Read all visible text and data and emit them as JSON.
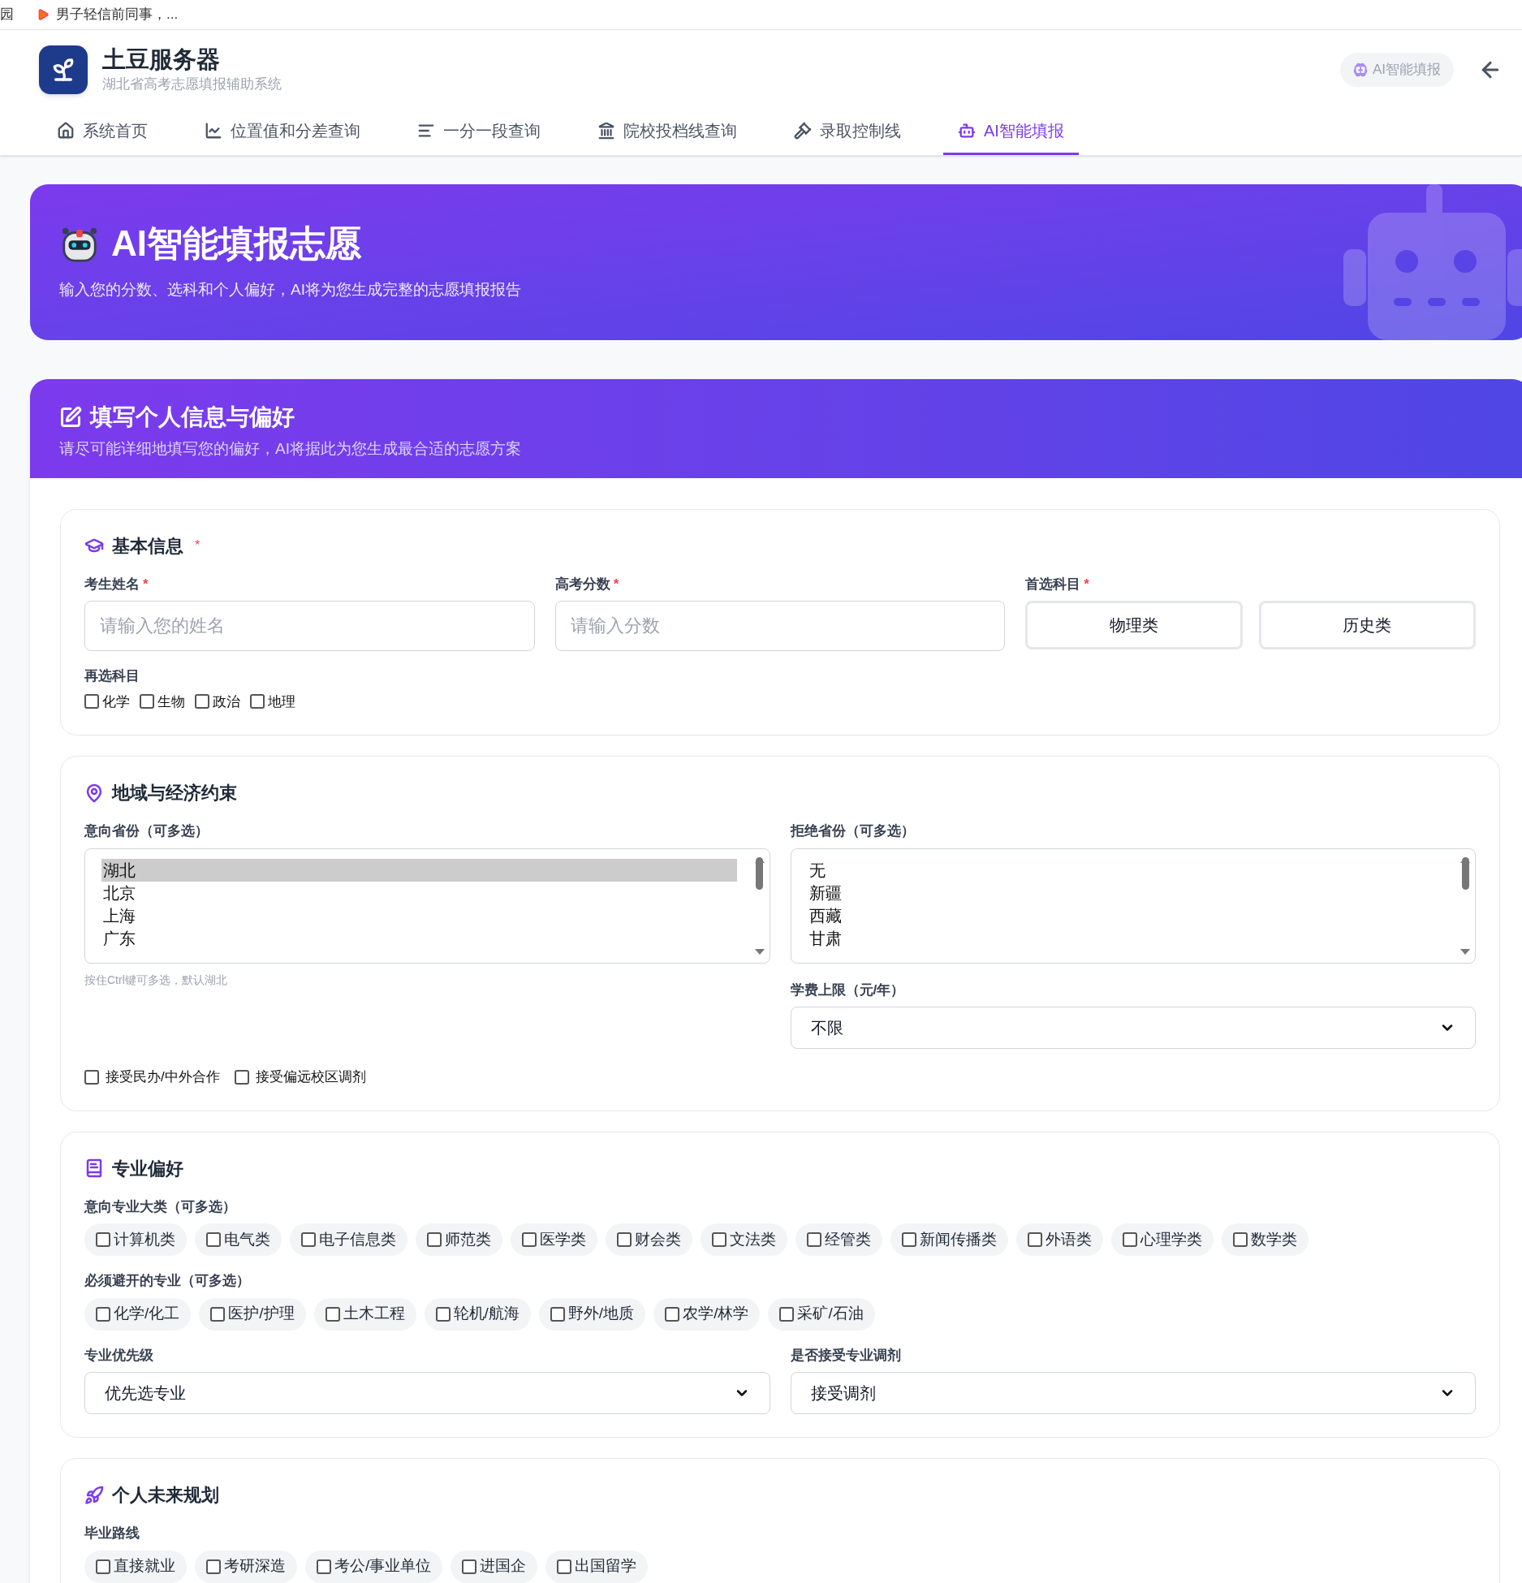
{
  "bookmarks": [
    {
      "label": "园"
    },
    {
      "label": "男子轻信前同事，..."
    }
  ],
  "header": {
    "title": "土豆服务器",
    "subtitle": "湖北省高考志愿填报辅助系统",
    "ai_button": "AI智能填报"
  },
  "nav": [
    {
      "label": "系统首页",
      "selected": false
    },
    {
      "label": "位置值和分差查询",
      "selected": false
    },
    {
      "label": "一分一段查询",
      "selected": false
    },
    {
      "label": "院校投档线查询",
      "selected": false
    },
    {
      "label": "录取控制线",
      "selected": false
    },
    {
      "label": "AI智能填报",
      "selected": true
    }
  ],
  "hero": {
    "title": "AI智能填报志愿",
    "subtitle": "输入您的分数、选科和个人偏好，AI将为您生成完整的志愿填报报告"
  },
  "form_header": {
    "title": "填写个人信息与偏好",
    "subtitle": "请尽可能详细地填写您的偏好，AI将据此为您生成最合适的志愿方案"
  },
  "basic_info": {
    "title": "基本信息",
    "required_mark": "*",
    "name_field": {
      "label": "考生姓名",
      "required_mark": "*",
      "placeholder": "请输入您的姓名"
    },
    "score_field": {
      "label": "高考分数",
      "required_mark": "*",
      "placeholder": "请输入分数"
    },
    "primary_subject": {
      "label": "首选科目",
      "required_mark": "*",
      "options": [
        {
          "label": "物理类",
          "selected": false
        },
        {
          "label": "历史类",
          "selected": false
        }
      ]
    },
    "elective_subjects": {
      "label": "再选科目",
      "options": [
        {
          "label": "化学",
          "checked": false
        },
        {
          "label": "生物",
          "checked": false
        },
        {
          "label": "政治",
          "checked": false
        },
        {
          "label": "地理",
          "checked": false
        }
      ]
    }
  },
  "region": {
    "title": "地域与经济约束",
    "preferred_provinces": {
      "label": "意向省份（可多选）",
      "options": [
        {
          "label": "湖北",
          "selected": true
        },
        {
          "label": "北京",
          "selected": false
        },
        {
          "label": "上海",
          "selected": false
        },
        {
          "label": "广东",
          "selected": false
        }
      ],
      "hint": "按住Ctrl键可多选，默认湖北"
    },
    "rejected_provinces": {
      "label": "拒绝省份（可多选）",
      "options": [
        {
          "label": "无",
          "selected": false
        },
        {
          "label": "新疆",
          "selected": false
        },
        {
          "label": "西藏",
          "selected": false
        },
        {
          "label": "甘肃",
          "selected": false
        }
      ]
    },
    "tuition": {
      "label": "学费上限（元/年）",
      "value": "不限"
    },
    "toggles": [
      {
        "label": "接受民办/中外合作",
        "checked": false
      },
      {
        "label": "接受偏远校区调剂",
        "checked": false
      }
    ]
  },
  "majors": {
    "title": "专业偏好",
    "preferred": {
      "label": "意向专业大类（可多选）",
      "options": [
        {
          "label": "计算机类",
          "checked": false
        },
        {
          "label": "电气类",
          "checked": false
        },
        {
          "label": "电子信息类",
          "checked": false
        },
        {
          "label": "师范类",
          "checked": false
        },
        {
          "label": "医学类",
          "checked": false
        },
        {
          "label": "财会类",
          "checked": false
        },
        {
          "label": "文法类",
          "checked": false
        },
        {
          "label": "经管类",
          "checked": false
        },
        {
          "label": "新闻传播类",
          "checked": false
        },
        {
          "label": "外语类",
          "checked": false
        },
        {
          "label": "心理学类",
          "checked": false
        },
        {
          "label": "数学类",
          "checked": false
        }
      ]
    },
    "avoided": {
      "label": "必须避开的专业（可多选）",
      "options": [
        {
          "label": "化学/化工",
          "checked": false
        },
        {
          "label": "医护/护理",
          "checked": false
        },
        {
          "label": "土木工程",
          "checked": false
        },
        {
          "label": "轮机/航海",
          "checked": false
        },
        {
          "label": "野外/地质",
          "checked": false
        },
        {
          "label": "农学/林学",
          "checked": false
        },
        {
          "label": "采矿/石油",
          "checked": false
        }
      ]
    },
    "priority": {
      "label": "专业优先级",
      "value": "优先选专业"
    },
    "adjustment": {
      "label": "是否接受专业调剂",
      "value": "接受调剂"
    }
  },
  "future": {
    "title": "个人未来规划",
    "routes": {
      "label": "毕业路线",
      "options": [
        {
          "label": "直接就业",
          "checked": false
        },
        {
          "label": "考研深造",
          "checked": false
        },
        {
          "label": "考公/事业单位",
          "checked": false
        },
        {
          "label": "进国企",
          "checked": false
        },
        {
          "label": "出国留学",
          "checked": false
        }
      ]
    }
  }
}
